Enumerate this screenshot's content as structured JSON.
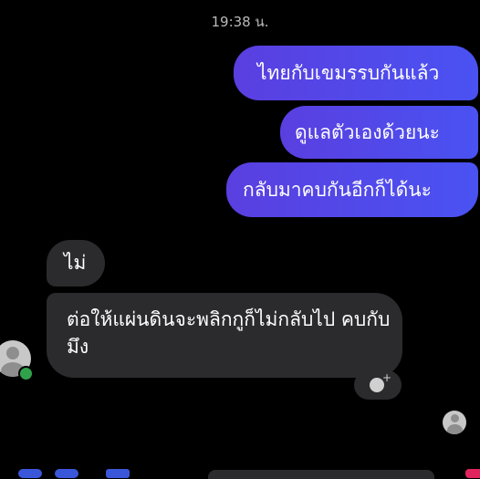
{
  "conversation": {
    "timestamp": "19:38 น.",
    "messages": [
      {
        "side": "outgoing",
        "text": "ไทยกับเขมรรบกันแล้ว"
      },
      {
        "side": "outgoing",
        "text": "ดูแลตัวเองด้วยนะ"
      },
      {
        "side": "outgoing",
        "text": "กลับมาคบกันอีกก็ได้นะ"
      },
      {
        "side": "incoming",
        "text": "ไม่"
      },
      {
        "side": "incoming",
        "text": "ต่อให้แผ่นดินจะพลิกกูก็ไม่กลับไป คบกับมึง"
      }
    ]
  },
  "colors": {
    "background": "#000000",
    "outgoing_bubble": "#5a3fe0",
    "incoming_bubble": "#2b2b2e",
    "online_dot": "#31a24c"
  },
  "icons": {
    "react": "emoji-add-icon",
    "contact_avatar": "avatar-icon",
    "seen": "seen-avatar-icon"
  }
}
